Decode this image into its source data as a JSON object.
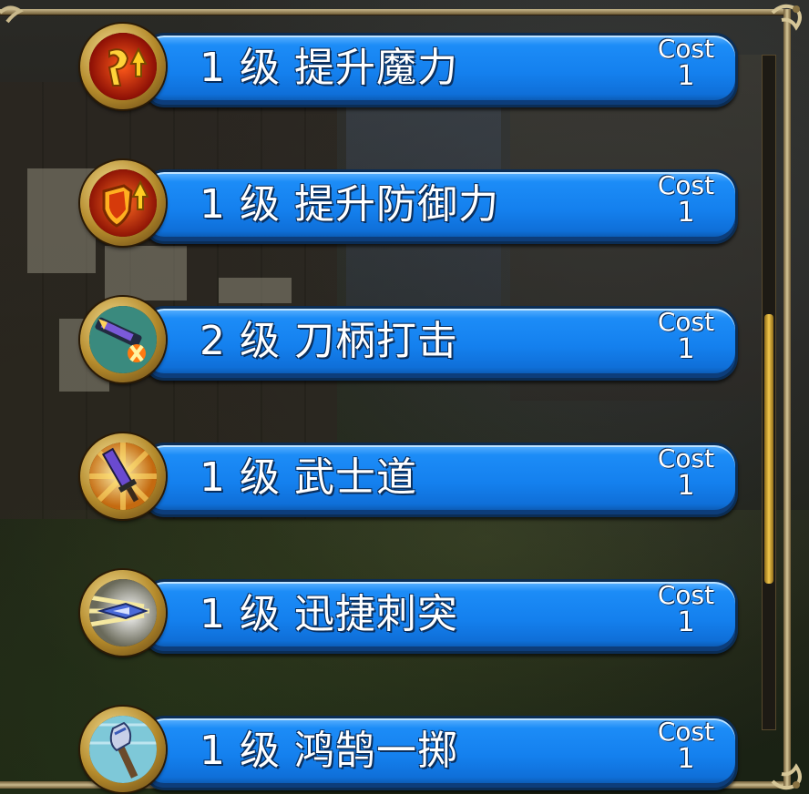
{
  "skills": [
    {
      "level": "1",
      "level_unit": "级",
      "name": "提升魔力",
      "cost_label": "Cost",
      "cost_value": "1",
      "icon": "magic-power-up-icon"
    },
    {
      "level": "1",
      "level_unit": "级",
      "name": "提升防御力",
      "cost_label": "Cost",
      "cost_value": "1",
      "icon": "defense-up-icon"
    },
    {
      "level": "2",
      "level_unit": "级",
      "name": "刀柄打击",
      "cost_label": "Cost",
      "cost_value": "1",
      "icon": "hilt-strike-icon"
    },
    {
      "level": "1",
      "level_unit": "级",
      "name": "武士道",
      "cost_label": "Cost",
      "cost_value": "1",
      "icon": "bushido-sword-icon"
    },
    {
      "level": "1",
      "level_unit": "级",
      "name": "迅捷刺突",
      "cost_label": "Cost",
      "cost_value": "1",
      "icon": "swift-thrust-icon"
    },
    {
      "level": "1",
      "level_unit": "级",
      "name": "鸿鹄一掷",
      "cost_label": "Cost",
      "cost_value": "1",
      "icon": "axe-throw-icon"
    }
  ],
  "scrollbar": {
    "position": 0.55,
    "visible_fraction": 0.5
  },
  "colors": {
    "bar": "#1480ee",
    "bar_border": "#0b2d55",
    "thumb": "#f3c84a",
    "frame": "#c9b98c"
  }
}
